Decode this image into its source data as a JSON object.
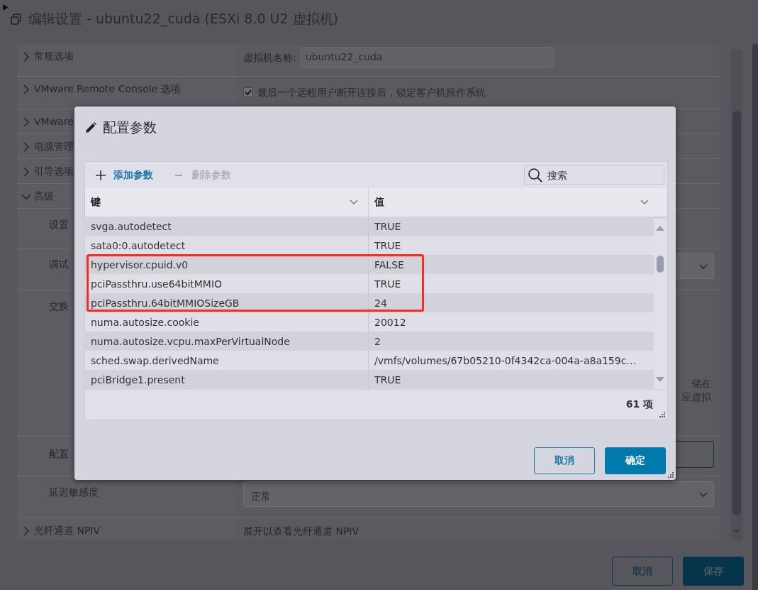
{
  "window": {
    "title": "编辑设置 - ubuntu22_cuda (ESXi 8.0 U2 虚拟机)"
  },
  "sections": [
    {
      "label": "常规选项",
      "expanded": false,
      "field_label": "虚拟机名称:",
      "field_value": "ubuntu22_cuda"
    },
    {
      "label": "VMware Remote Console 选项",
      "expanded": false,
      "checkbox": {
        "label": "最后一个远程用户断开连接后，锁定客户机操作系统",
        "checked": true,
        "disabled": true
      }
    },
    {
      "label": "VMware",
      "expanded": false
    },
    {
      "label": "电源管理",
      "expanded": false
    },
    {
      "label": "引导选项",
      "expanded": false
    },
    {
      "label": "高级",
      "expanded": true,
      "children": [
        {
          "label": "设置",
          "kind": "plain"
        },
        {
          "label": "调试",
          "kind": "select"
        },
        {
          "label": "交换",
          "kind": "text",
          "lines": [
            "储在",
            "应虚拟"
          ]
        },
        {
          "label": "配置",
          "kind": "button"
        },
        {
          "label": "延迟敏感度",
          "kind": "select",
          "value": "正常"
        }
      ]
    },
    {
      "label": "光纤通道 NPIV",
      "expanded": false,
      "value_text": "展开以查看光纤通道 NPIV"
    }
  ],
  "dialog": {
    "title": "配置参数",
    "toolbar": [
      {
        "label": "添加参数",
        "kind": "add",
        "disabled": false
      },
      {
        "label": "删除参数",
        "kind": "remove",
        "disabled": true
      }
    ],
    "search": {
      "placeholder": "搜索"
    },
    "columns": [
      "键",
      "值"
    ],
    "rows": [
      {
        "key": "svga.autodetect",
        "value": "TRUE",
        "highlighted": false
      },
      {
        "key": "sata0:0.autodetect",
        "value": "TRUE",
        "highlighted": false
      },
      {
        "key": "hypervisor.cpuid.v0",
        "value": "FALSE",
        "highlighted": true
      },
      {
        "key": "pciPassthru.use64bitMMIO",
        "value": "TRUE",
        "highlighted": true
      },
      {
        "key": "pciPassthru.64bitMMIOSizeGB",
        "value": "24",
        "highlighted": true
      },
      {
        "key": "numa.autosize.cookie",
        "value": "20012",
        "highlighted": false
      },
      {
        "key": "numa.autosize.vcpu.maxPerVirtualNode",
        "value": "2",
        "highlighted": false
      },
      {
        "key": "sched.swap.derivedName",
        "value": "/vmfs/volumes/67b05210-0f4342ca-004a-a8a159c…",
        "highlighted": false
      },
      {
        "key": "pciBridge1.present",
        "value": "TRUE",
        "highlighted": false
      }
    ],
    "count": "61 项",
    "buttons": [
      {
        "label": "取消",
        "kind": "secondary"
      },
      {
        "label": "确定",
        "kind": "primary"
      }
    ]
  },
  "footer_buttons": [
    {
      "label": "取消",
      "kind": "secondary"
    },
    {
      "label": "保存",
      "kind": "primary"
    }
  ]
}
